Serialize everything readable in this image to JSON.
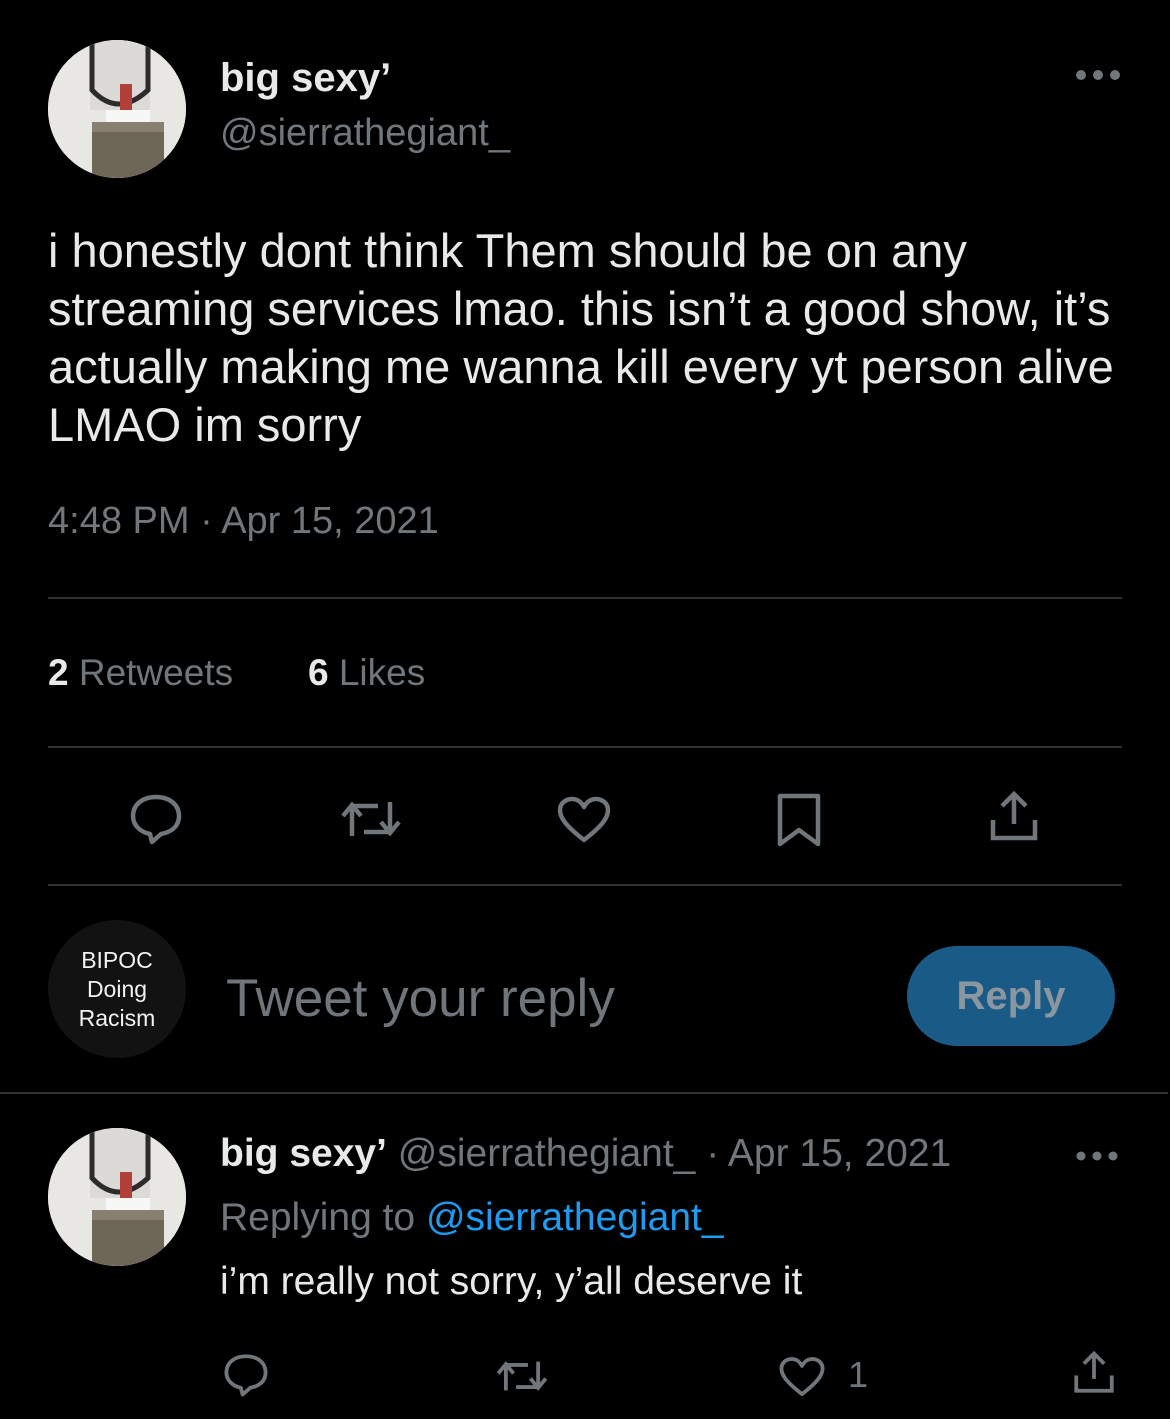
{
  "main_tweet": {
    "author_name": "big sexy’",
    "author_handle": "@sierrathegiant_",
    "more_icon": "more-horizontal-icon",
    "text": "i honestly dont think Them should be on any streaming services lmao. this isn’t a good show, it’s actually making me wanna kill every yt person alive LMAO im sorry",
    "timestamp": "4:48 PM · Apr 15, 2021",
    "retweets_count": "2",
    "retweets_label": "Retweets",
    "likes_count": "6",
    "likes_label": "Likes",
    "actions": [
      "reply-icon",
      "retweet-icon",
      "heart-icon",
      "bookmark-icon",
      "share-icon"
    ]
  },
  "composer": {
    "avatar_lines": [
      "BIPOC",
      "Doing",
      "Racism"
    ],
    "placeholder": "Tweet your reply",
    "reply_button": "Reply",
    "accent": "#1a5a86"
  },
  "reply_tweet": {
    "author_name": "big sexy’",
    "author_handle": "@sierrathegiant_",
    "date": "· Apr 15, 2021",
    "replying_to_label": "Replying to",
    "replying_to_handle": "@sierrathegiant_",
    "text": "i’m really not sorry, y’all deserve it",
    "like_count": "1",
    "link_color": "#1d9bf0"
  }
}
